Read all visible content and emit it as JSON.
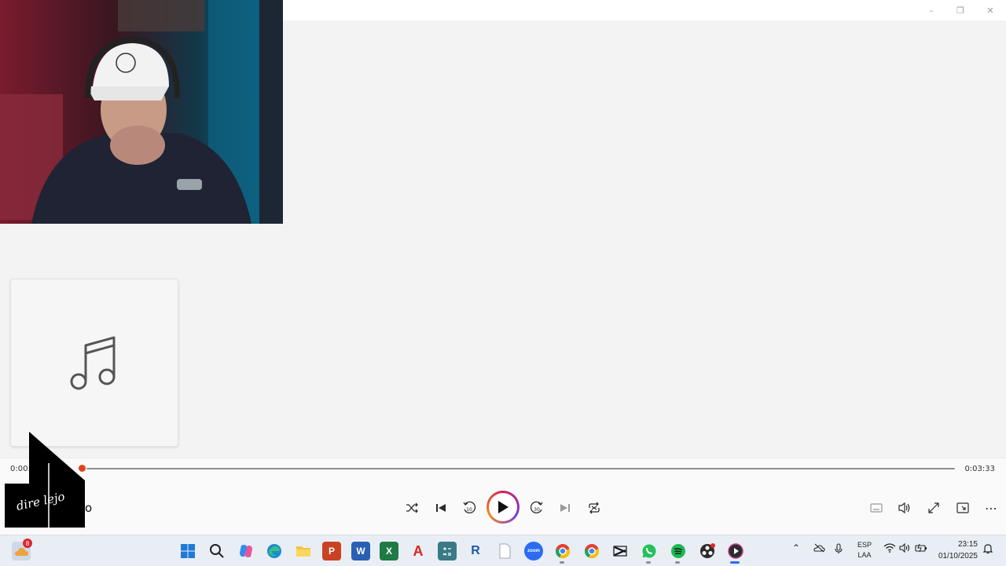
{
  "window": {
    "minimize_label": "–",
    "restore_label": "❐",
    "close_label": "✕"
  },
  "player": {
    "current_time": "0:00:03",
    "total_time": "0:03:33",
    "progress_fraction": 0.0,
    "song_title": "o",
    "album_art_icon": "music-note-icon",
    "controls": {
      "shuffle": "shuffle-icon",
      "previous": "previous-track-icon",
      "rewind": "rewind-10-icon",
      "rewind_label": "10",
      "play": "play-icon",
      "forward": "forward-30-icon",
      "forward_label": "30",
      "next": "next-track-icon",
      "repeat": "repeat-icon"
    },
    "right_controls": {
      "captions": "captions-icon",
      "volume": "volume-icon",
      "fullscreen": "fullscreen-icon",
      "miniplayer": "mini-player-icon",
      "more": "⋯"
    },
    "accent_color": "#e0441b"
  },
  "overlay_logo": {
    "text": "dire lejo"
  },
  "taskbar": {
    "weather_badge": "8",
    "apps": [
      {
        "name": "start",
        "label": ""
      },
      {
        "name": "search",
        "label": ""
      },
      {
        "name": "copilot",
        "label": ""
      },
      {
        "name": "edge",
        "label": ""
      },
      {
        "name": "file-explorer",
        "label": ""
      },
      {
        "name": "powerpoint",
        "label": "P"
      },
      {
        "name": "word",
        "label": "W"
      },
      {
        "name": "excel",
        "label": "X"
      },
      {
        "name": "acrobat",
        "label": "A"
      },
      {
        "name": "calculator",
        "label": ""
      },
      {
        "name": "r-app",
        "label": "R"
      },
      {
        "name": "notepad",
        "label": ""
      },
      {
        "name": "zoom",
        "label": "zoom"
      },
      {
        "name": "chrome-1",
        "label": ""
      },
      {
        "name": "chrome-2",
        "label": ""
      },
      {
        "name": "capcut",
        "label": ""
      },
      {
        "name": "whatsapp",
        "label": ""
      },
      {
        "name": "spotify",
        "label": ""
      },
      {
        "name": "obs",
        "label": ""
      },
      {
        "name": "media-player",
        "label": ""
      }
    ],
    "language_top": "ESP",
    "language_bottom": "LAA",
    "time": "23:15",
    "date": "01/10/2025"
  }
}
